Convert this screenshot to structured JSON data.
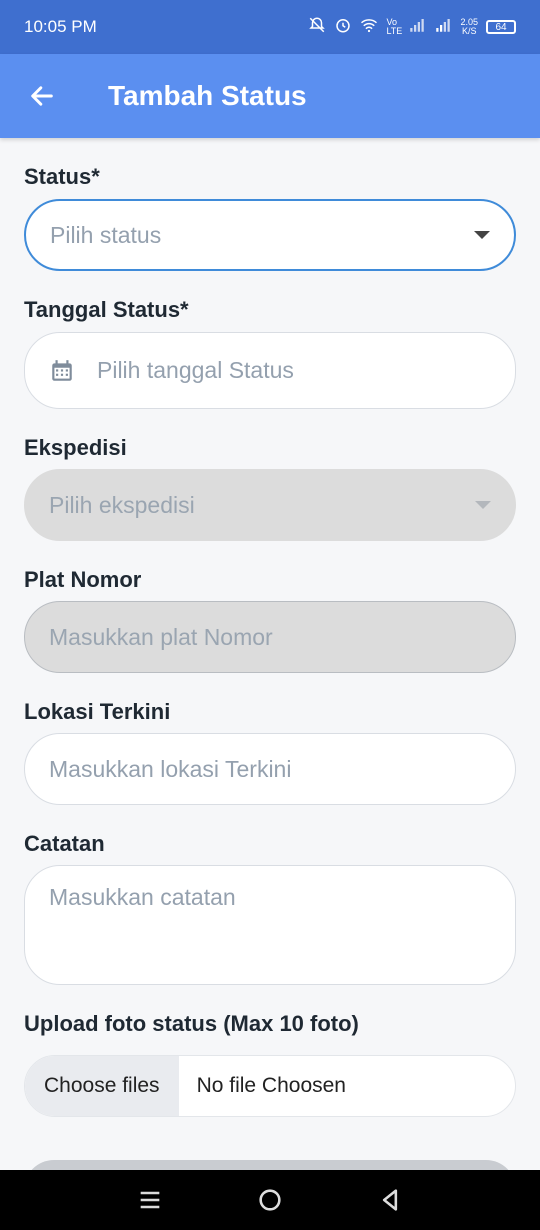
{
  "status_bar": {
    "time": "10:05 PM",
    "network_speed_value": "2.05",
    "network_speed_unit": "K/S",
    "battery": "64",
    "volte": "Vo LTE",
    "icons": [
      "mute-icon",
      "alarm-icon",
      "wifi-icon",
      "signal-icon",
      "signal-icon",
      "battery-icon"
    ]
  },
  "app_bar": {
    "title": "Tambah Status",
    "color": "#5b8ff0"
  },
  "form": {
    "status": {
      "label": "Status*",
      "placeholder": "Pilih status"
    },
    "tanggal": {
      "label": "Tanggal Status*",
      "placeholder": "Pilih tanggal Status"
    },
    "ekspedisi": {
      "label": "Ekspedisi",
      "placeholder": "Pilih ekspedisi"
    },
    "plat": {
      "label": "Plat Nomor",
      "placeholder": "Masukkan plat Nomor"
    },
    "lokasi": {
      "label": "Lokasi Terkini",
      "placeholder": "Masukkan lokasi Terkini"
    },
    "catatan": {
      "label": "Catatan",
      "placeholder": "Masukkan catatan"
    },
    "upload": {
      "label": "Upload foto status (Max 10 foto)",
      "button": "Choose files",
      "status": "No file Choosen"
    }
  }
}
